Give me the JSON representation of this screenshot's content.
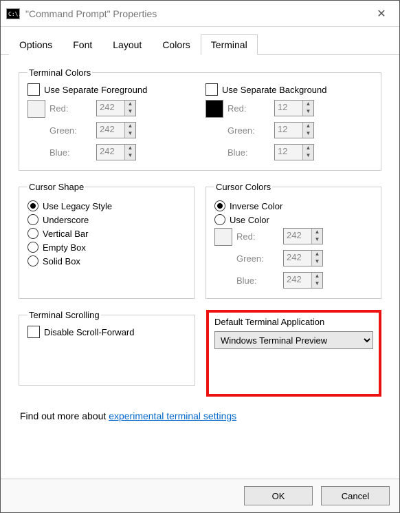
{
  "window": {
    "title": "\"Command Prompt\" Properties",
    "icon_text": "C:\\."
  },
  "tabs": [
    "Options",
    "Font",
    "Layout",
    "Colors",
    "Terminal"
  ],
  "active_tab": 4,
  "terminalColors": {
    "legend": "Terminal Colors",
    "fg": {
      "label": "Use Separate Foreground",
      "checked": false,
      "swatch": "#f2f2f2",
      "red": 242,
      "green": 242,
      "blue": 242,
      "enabled": false
    },
    "bg": {
      "label": "Use Separate Background",
      "checked": false,
      "swatch": "#000000",
      "red": 12,
      "green": 12,
      "blue": 12,
      "enabled": false
    },
    "labels": {
      "red": "Red:",
      "green": "Green:",
      "blue": "Blue:"
    }
  },
  "cursorShape": {
    "legend": "Cursor Shape",
    "options": [
      "Use Legacy Style",
      "Underscore",
      "Vertical Bar",
      "Empty Box",
      "Solid Box"
    ],
    "selected": 0
  },
  "cursorColors": {
    "legend": "Cursor Colors",
    "options": [
      "Inverse Color",
      "Use Color"
    ],
    "selected": 0,
    "swatch": "#f2f2f2",
    "red": 242,
    "green": 242,
    "blue": 242,
    "enabled": false,
    "labels": {
      "red": "Red:",
      "green": "Green:",
      "blue": "Blue:"
    }
  },
  "terminalScrolling": {
    "legend": "Terminal Scrolling",
    "label": "Disable Scroll-Forward",
    "checked": false
  },
  "defaultTerminal": {
    "legend": "Default Terminal Application",
    "value": "Windows Terminal Preview",
    "options": [
      "Windows Terminal Preview"
    ]
  },
  "linkLine": {
    "prefix": "Find out more about ",
    "linkText": "experimental terminal settings"
  },
  "buttons": {
    "ok": "OK",
    "cancel": "Cancel"
  }
}
